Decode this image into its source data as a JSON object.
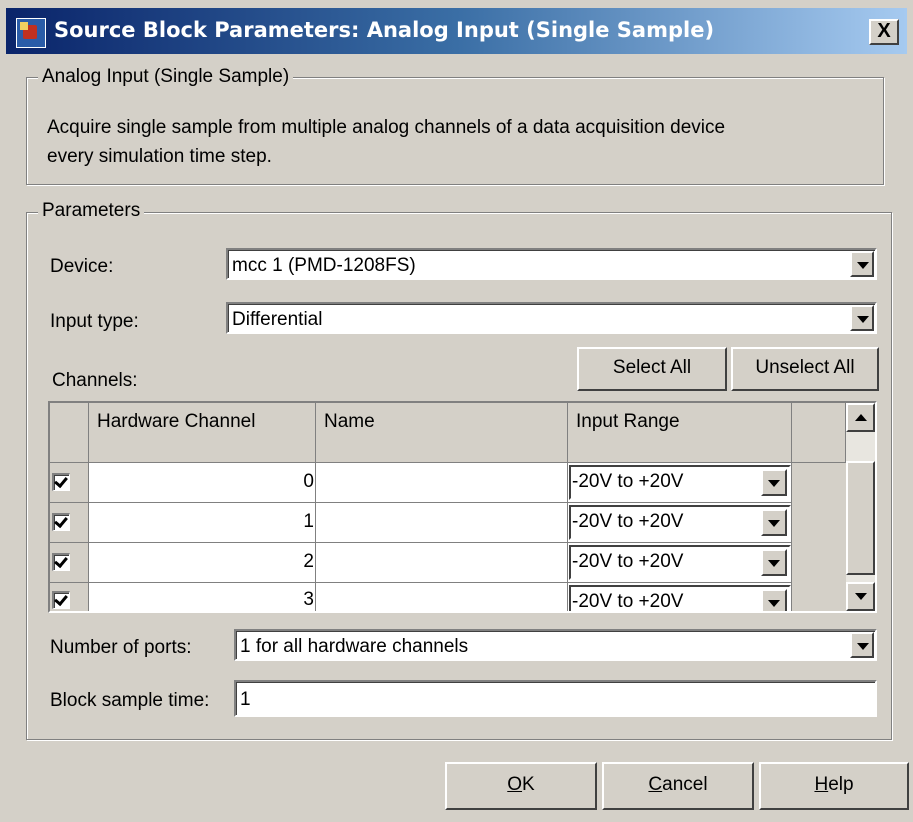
{
  "window": {
    "title": "Source Block Parameters: Analog Input (Single Sample)",
    "close_label": "X"
  },
  "description_group": {
    "legend": "Analog Input (Single Sample)",
    "text_line1": "Acquire single sample from multiple analog channels of a data acquisition device",
    "text_line2": "every simulation time step."
  },
  "parameters": {
    "legend": "Parameters",
    "device": {
      "label": "Device:",
      "value": "mcc 1 (PMD-1208FS)"
    },
    "input_type": {
      "label": "Input type:",
      "value": "Differential"
    },
    "channels_label": "Channels:",
    "select_all_label": "Select All",
    "unselect_all_label": "Unselect All",
    "table": {
      "columns": [
        "Hardware Channel",
        "Name",
        "Input Range"
      ],
      "rows": [
        {
          "checked": true,
          "channel": "0",
          "name": "",
          "range": "-20V to +20V"
        },
        {
          "checked": true,
          "channel": "1",
          "name": "",
          "range": "-20V to +20V"
        },
        {
          "checked": true,
          "channel": "2",
          "name": "",
          "range": "-20V to +20V"
        },
        {
          "checked": true,
          "channel": "3",
          "name": "",
          "range": "-20V to +20V"
        }
      ]
    },
    "num_ports": {
      "label": "Number of ports:",
      "value": "1 for all hardware channels"
    },
    "sample_time": {
      "label": "Block sample time:",
      "value": "1"
    }
  },
  "buttons": {
    "ok": {
      "underline": "O",
      "rest": "K"
    },
    "cancel": {
      "underline": "C",
      "rest": "ancel"
    },
    "help": {
      "underline": "H",
      "rest": "elp"
    }
  },
  "colors": {
    "dialog_bg": "#d4d0c8",
    "title_gradient_start": "#0a246a",
    "title_gradient_end": "#a6caf0"
  }
}
